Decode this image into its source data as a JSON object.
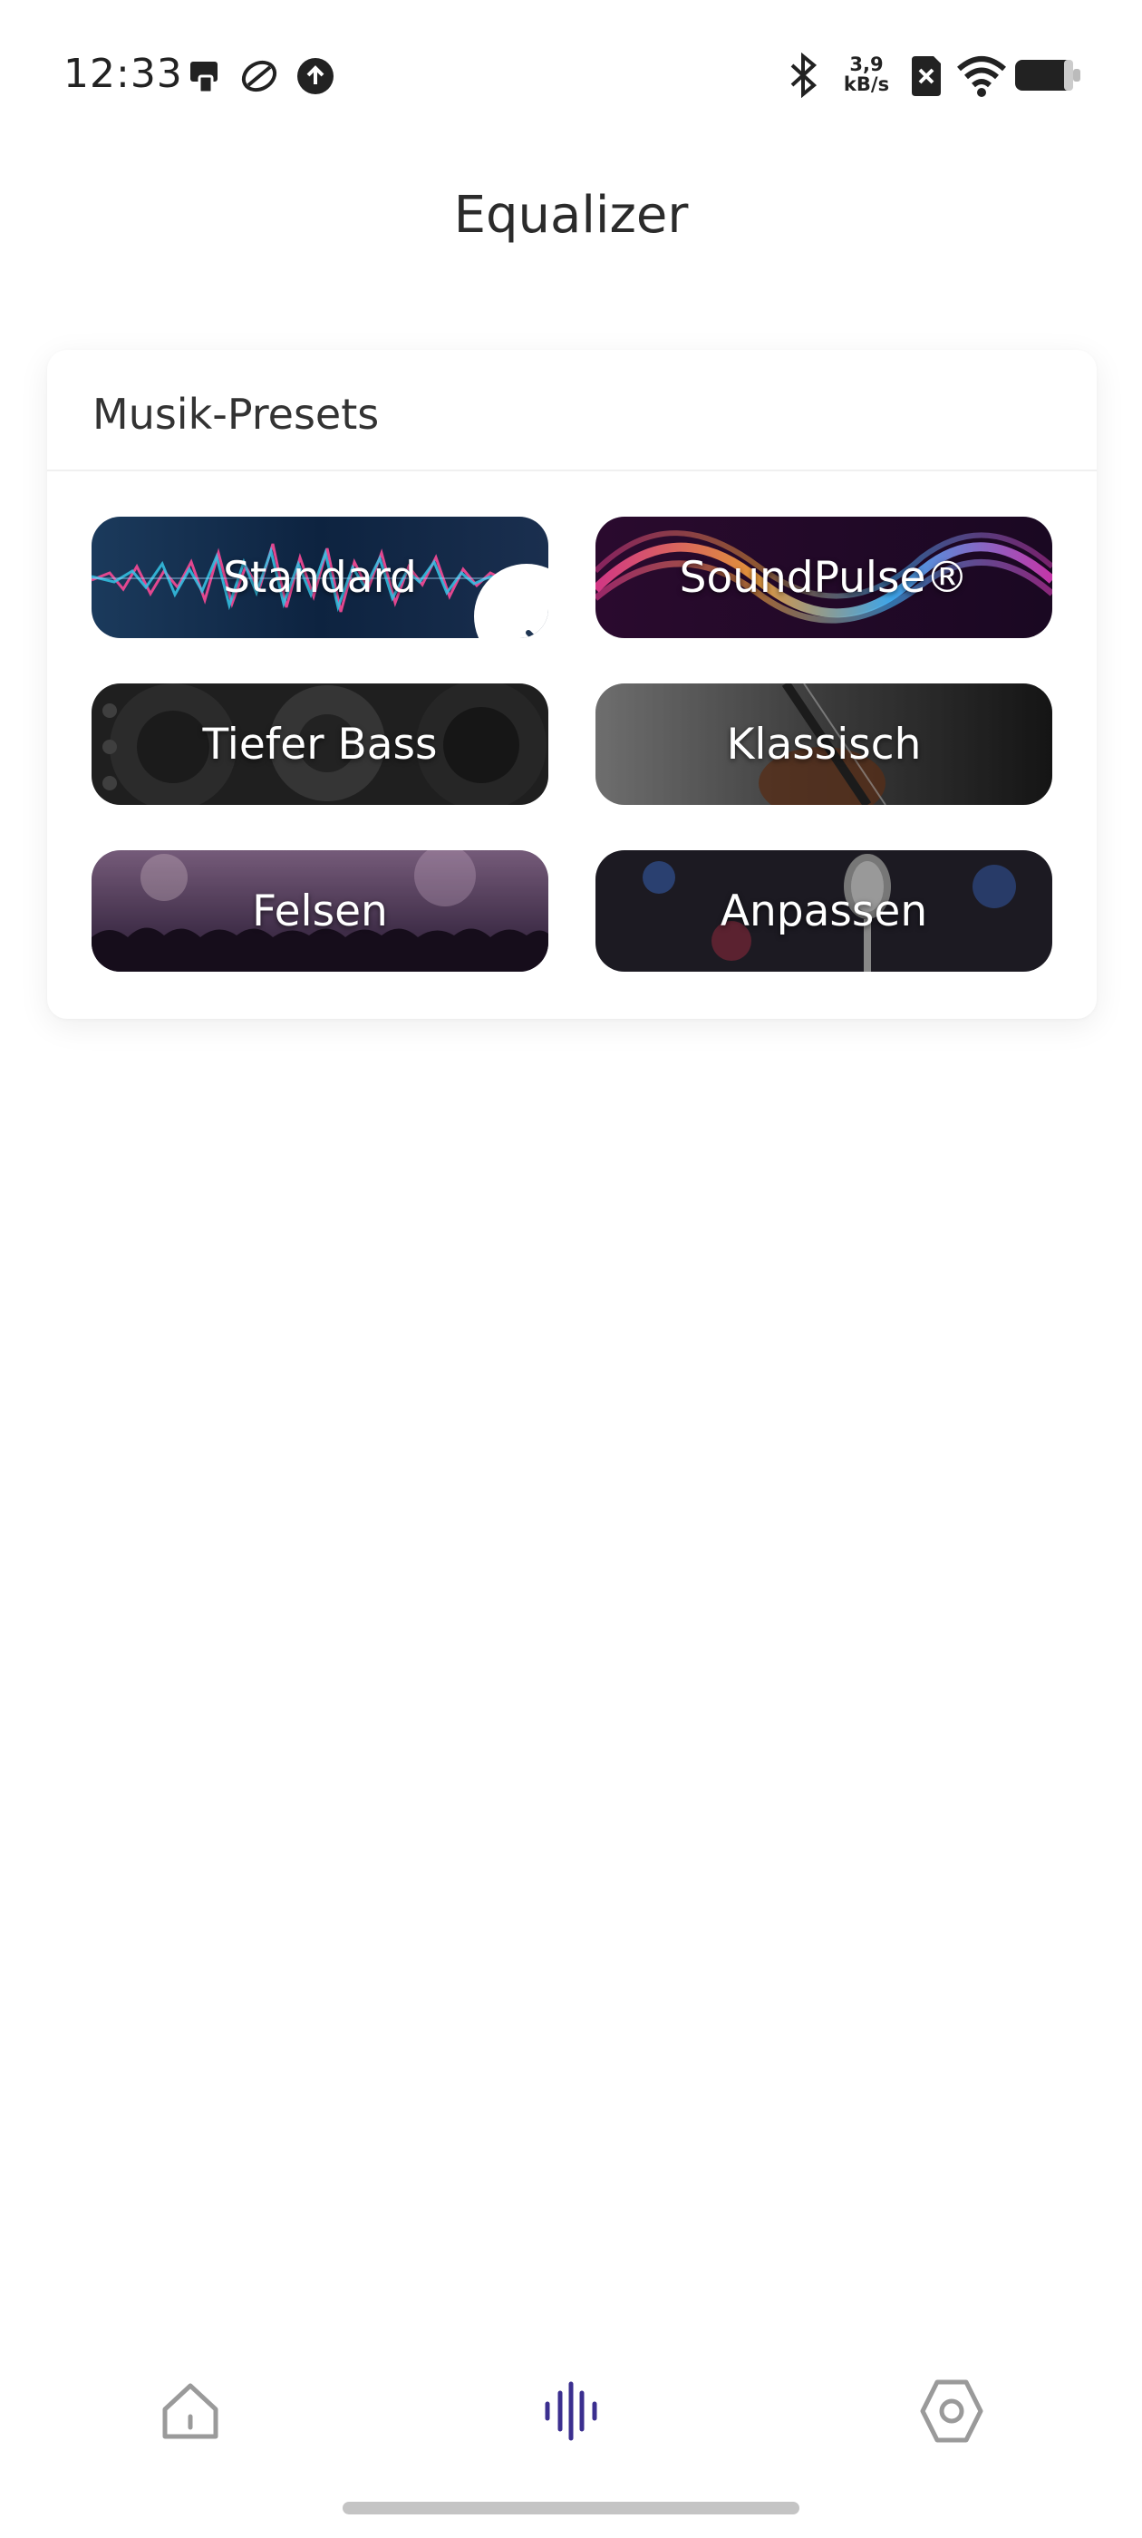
{
  "status_bar": {
    "time": "12:33",
    "net_speed_value": "3,9",
    "net_speed_unit": "kB/s",
    "left_icons": [
      "notification-app-icon",
      "sync-icon",
      "upload-icon"
    ],
    "right_icons": [
      "bluetooth-icon",
      "sim-off-icon",
      "wifi-icon",
      "battery-icon"
    ]
  },
  "page": {
    "title": "Equalizer"
  },
  "presets_card": {
    "title": "Musik-Presets",
    "selected": "Standard",
    "items": [
      {
        "label": "Standard",
        "selected": true
      },
      {
        "label": "SoundPulse®",
        "selected": false
      },
      {
        "label": "Tiefer Bass",
        "selected": false
      },
      {
        "label": "Klassisch",
        "selected": false
      },
      {
        "label": "Felsen",
        "selected": false
      },
      {
        "label": "Anpassen",
        "selected": false
      }
    ]
  },
  "bottom_nav": {
    "items": [
      {
        "icon": "home-icon",
        "active": false
      },
      {
        "icon": "equalizer-icon",
        "active": true
      },
      {
        "icon": "settings-icon",
        "active": false
      }
    ],
    "active_color": "#3b2f8f",
    "inactive_color": "#9a9a9a"
  }
}
